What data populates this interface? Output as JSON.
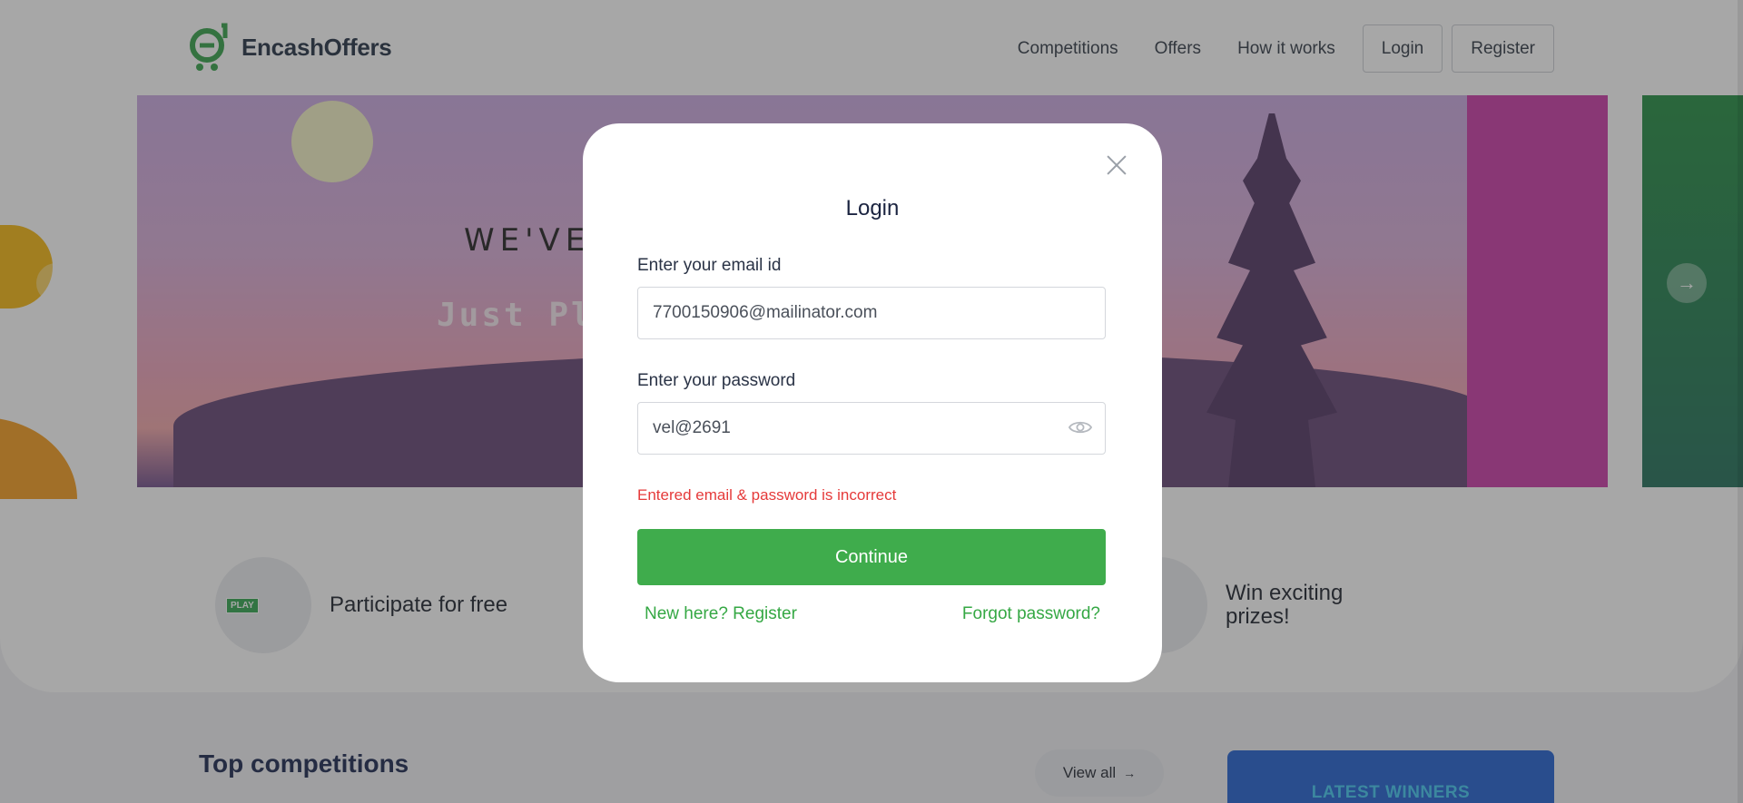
{
  "header": {
    "brand": "EncashOffers",
    "nav": [
      "Competitions",
      "Offers",
      "How it works"
    ],
    "login_label": "Login",
    "register_label": "Register"
  },
  "banner": {
    "headline": "WE'VE",
    "subline_start": "Just Pla",
    "subline_end": "l"
  },
  "features": {
    "participate": "Participate for free",
    "play_badge": "PLAY",
    "win": "Win exciting prizes!"
  },
  "sections": {
    "top_competitions": "Top competitions",
    "view_all": "View all",
    "latest_winners": "LATEST WINNERS"
  },
  "modal": {
    "title": "Login",
    "email_label": "Enter your email id",
    "email_value": "7700150906@mailinator.com",
    "password_label": "Enter your password",
    "password_value": "vel@2691",
    "error": "Entered email & password is incorrect",
    "continue_label": "Continue",
    "register_link": "New here? Register",
    "forgot_link": "Forgot password?"
  },
  "colors": {
    "brand_green": "#3fac4c",
    "error_red": "#e53a3a",
    "navy": "#13204a"
  }
}
